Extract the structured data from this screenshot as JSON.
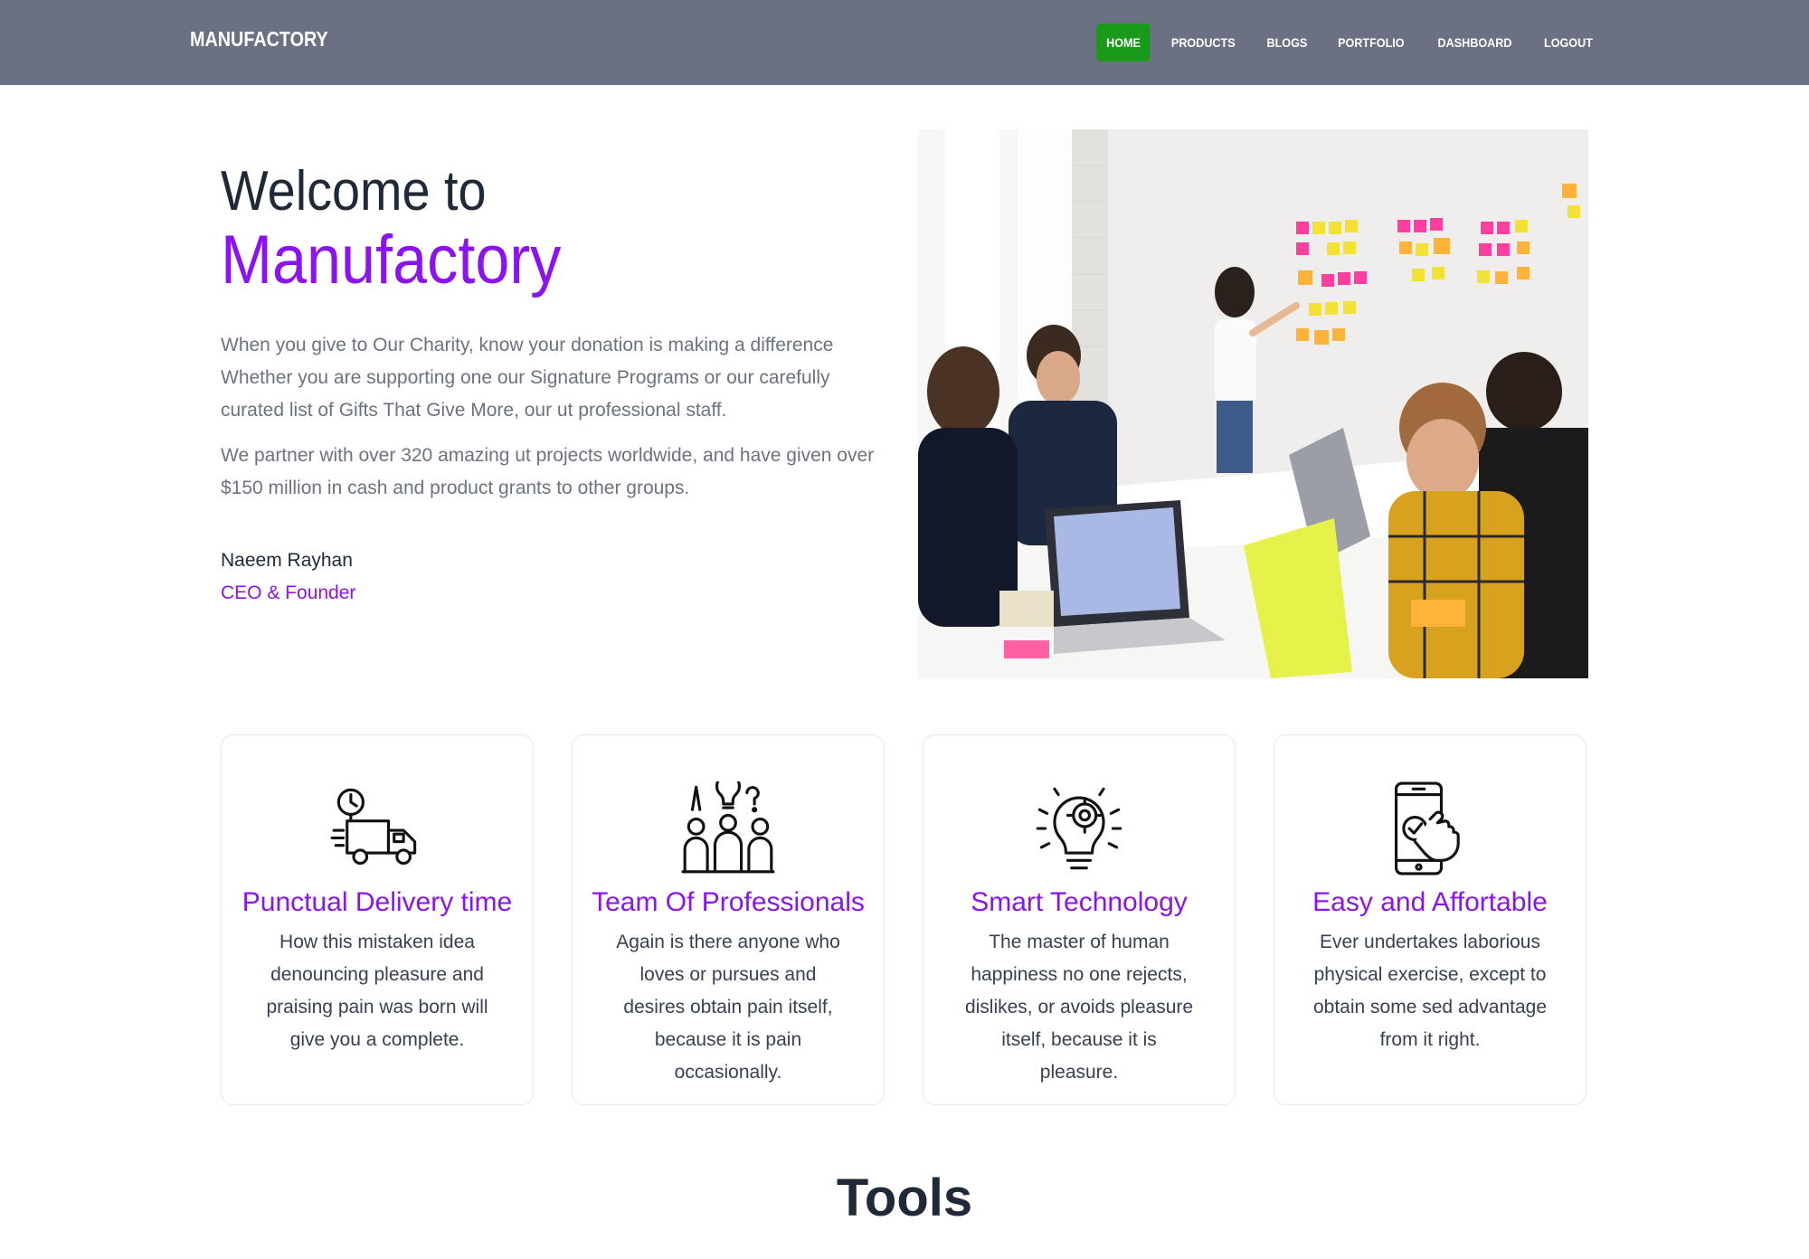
{
  "navbar": {
    "brand": "MANUFACTORY",
    "items": [
      {
        "label": "HOME",
        "active": true
      },
      {
        "label": "PRODUCTS"
      },
      {
        "label": "BLOGS"
      },
      {
        "label": "PORTFOLIO"
      },
      {
        "label": "DASHBOARD"
      },
      {
        "label": "LOGOUT"
      }
    ]
  },
  "hero": {
    "welcome": "Welcome to",
    "brand": "Manufactory",
    "para1": "When you give to Our Charity, know your donation is making a difference Whether you are supporting one our Signature Programs or our carefully curated list of Gifts That Give More, our ut professional staff.",
    "para2": "We partner with over 320 amazing ut projects worldwide, and have given over $150 million in cash and product grants to other groups.",
    "person_name": "Naeem Rayhan",
    "person_role": "CEO & Founder",
    "image_icon": "team-meeting-photo"
  },
  "features": [
    {
      "icon": "delivery-truck-icon",
      "title": "Punctual Delivery time",
      "text": "How this mistaken idea denouncing pleasure and praising pain was born will give you a complete."
    },
    {
      "icon": "team-ideas-icon",
      "title": "Team Of Professionals",
      "text": "Again is there anyone who loves or pursues and desires obtain pain itself, because it is pain occasionally."
    },
    {
      "icon": "smart-technology-icon",
      "title": "Smart Technology",
      "text": "The master of human happiness no one rejects, dislikes, or avoids pleasure itself, because it is pleasure."
    },
    {
      "icon": "mobile-touch-icon",
      "title": "Easy and Affortable",
      "text": "Ever undertakes laborious physical exercise, except to obtain some sed advantage from it right."
    }
  ],
  "tools": {
    "heading": "Tools"
  },
  "colors": {
    "navbar_bg": "#6b7183",
    "active_nav": "#1a9a1a",
    "accent": "#8a13f0"
  }
}
